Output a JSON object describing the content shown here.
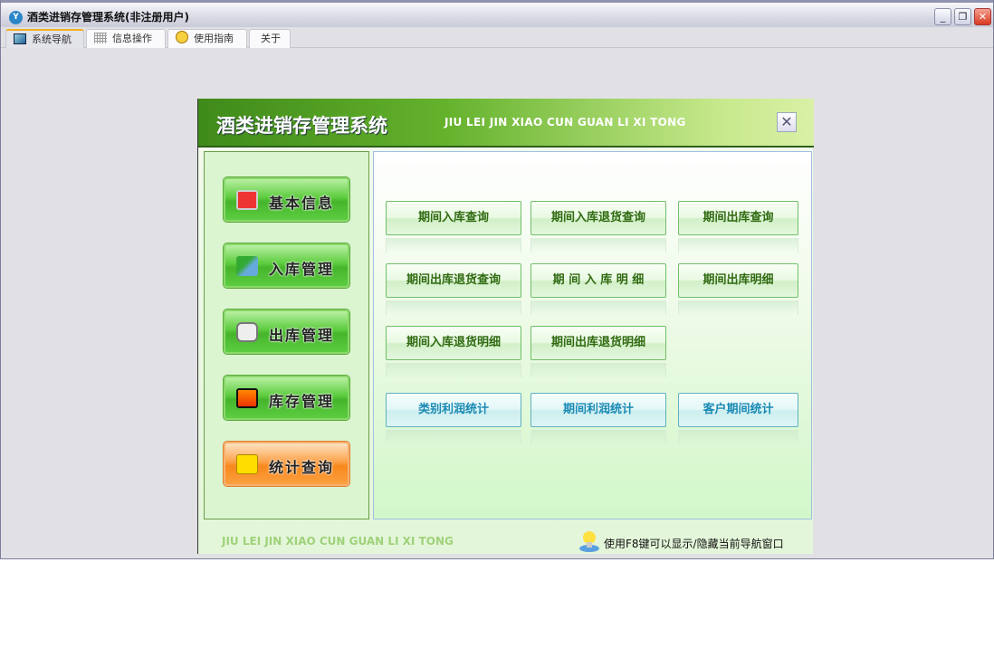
{
  "window": {
    "title": "酒类进销存管理系统(非注册用户)",
    "minimize": "_",
    "restore": "❐",
    "close": "✕"
  },
  "tabs": [
    {
      "label": "系统导航",
      "icon": "monitor-icon"
    },
    {
      "label": "信息操作",
      "icon": "grid-icon"
    },
    {
      "label": "使用指南",
      "icon": "help-icon"
    },
    {
      "label": "关于"
    }
  ],
  "panel": {
    "title": "酒类进销存管理系统",
    "subtitle": "JIU LEI JIN XIAO CUN GUAN LI XI TONG",
    "close": "✕",
    "footer_subtitle": "JIU LEI JIN XIAO CUN GUAN LI XI TONG",
    "hint": "使用F8键可以显示/隐藏当前导航窗口"
  },
  "nav": [
    {
      "label": "基本信息",
      "icon": "alert-monitor-icon"
    },
    {
      "label": "入库管理",
      "icon": "user-check-icon"
    },
    {
      "label": "出库管理",
      "icon": "contact-card-icon"
    },
    {
      "label": "库存管理",
      "icon": "monitor-icon"
    },
    {
      "label": "统计查询",
      "icon": "rss-icon"
    }
  ],
  "buttons": [
    "期间入库查询",
    "期间入库退货查询",
    "期间出库查询",
    "期间出库退货查询",
    "期 间 入 库 明 细",
    "期间出库明细",
    "期间入库退货明细",
    "期间出库退货明细",
    "类别利润统计",
    "期间利润统计",
    "客户期间统计"
  ],
  "colors": {
    "accent_green": "#4fbf33",
    "stats_orange": "#f8901f",
    "button_text": "#2f6a10",
    "stats_text": "#1a8ab5"
  }
}
